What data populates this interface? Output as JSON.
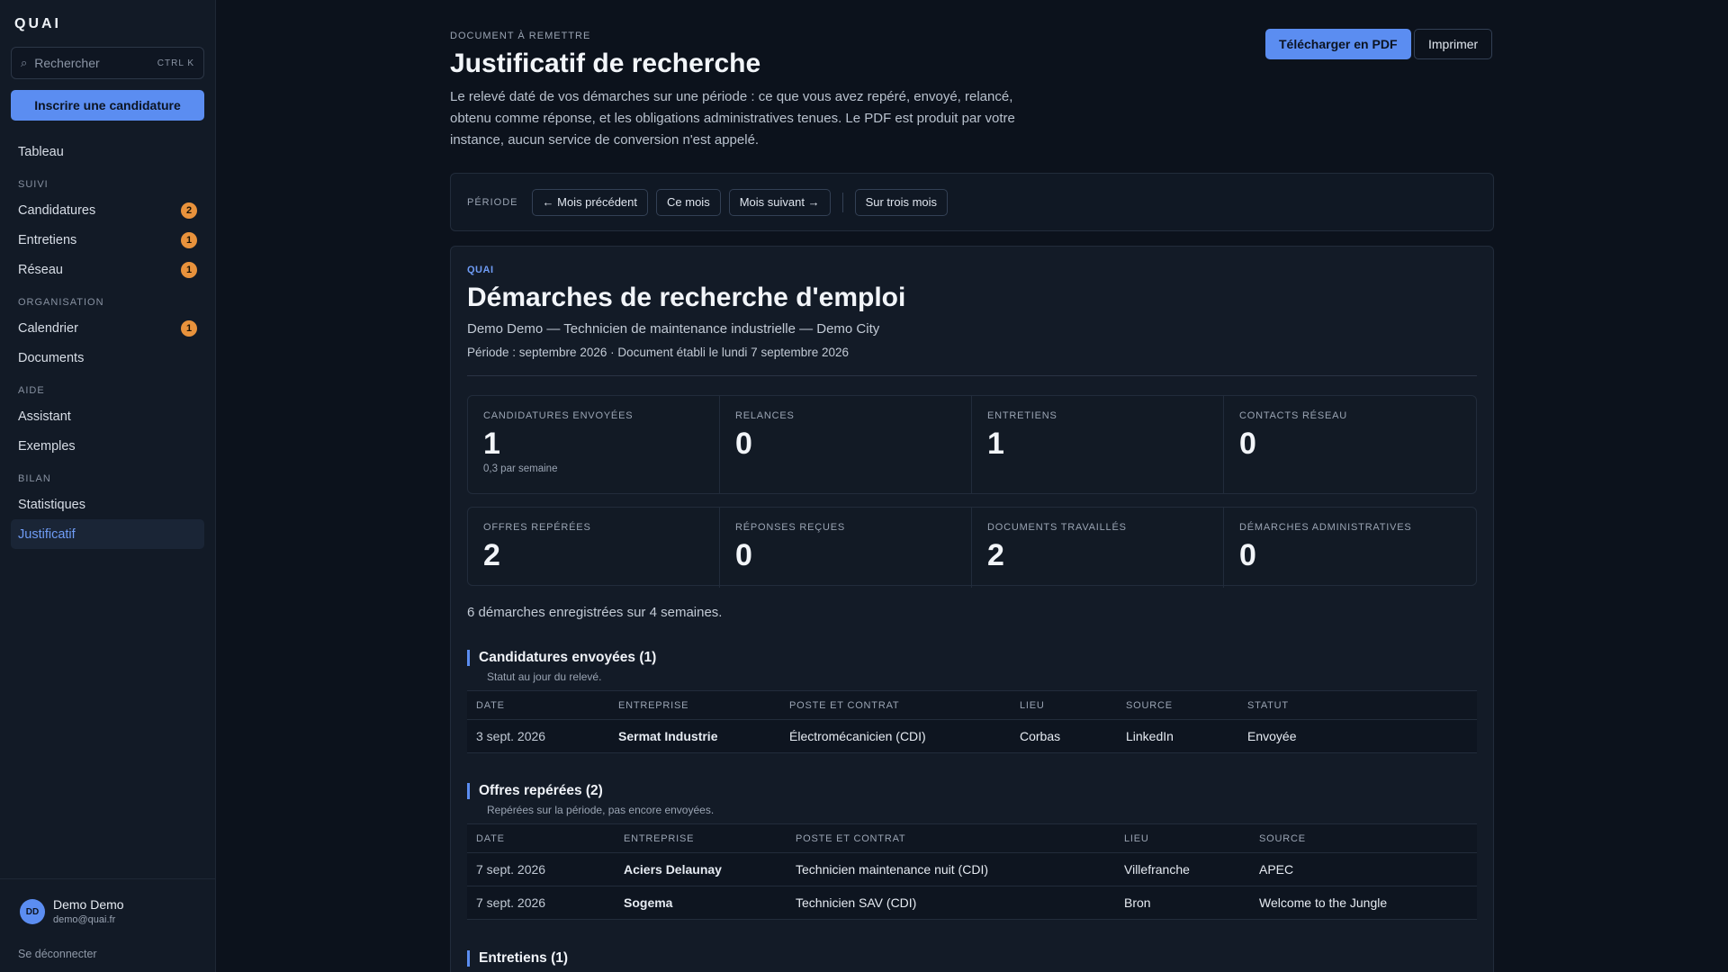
{
  "sidebar": {
    "brand": "QUAI",
    "search_placeholder": "Rechercher",
    "search_shortcut": "CTRL K",
    "cta": "Inscrire une candidature",
    "items": {
      "tableau": "Tableau",
      "suivi": "SUIVI",
      "candidatures": "Candidatures",
      "candidatures_count": "2",
      "entretiens": "Entretiens",
      "entretiens_count": "1",
      "reseau": "Réseau",
      "reseau_count": "1",
      "organisation": "ORGANISATION",
      "calendrier": "Calendrier",
      "calendrier_count": "1",
      "documents": "Documents",
      "aide": "AIDE",
      "assistant": "Assistant",
      "exemples": "Exemples",
      "bilan": "BILAN",
      "statistiques": "Statistiques",
      "justificatif": "Justificatif"
    },
    "user": {
      "initials": "DD",
      "name": "Demo Demo",
      "email": "demo@quai.fr"
    },
    "logout": "Se déconnecter"
  },
  "header": {
    "eyebrow": "DOCUMENT À REMETTRE",
    "title": "Justificatif de recherche",
    "intro": "Le relevé daté de vos démarches sur une période : ce que vous avez repéré, envoyé, relancé, obtenu comme réponse, et les obligations administratives tenues. Le PDF est produit par votre instance, aucun service de conversion n'est appelé.",
    "download": "Télécharger en PDF",
    "print": "Imprimer"
  },
  "period": {
    "label": "PÉRIODE",
    "prev": "← Mois précédent",
    "current": "Ce mois",
    "next": "Mois suivant →",
    "three": "Sur trois mois"
  },
  "doc": {
    "brand": "QUAI",
    "title": "Démarches de recherche d'emploi",
    "subtitle": "Demo Demo — Technicien de maintenance industrielle — Demo City",
    "meta": "Période : septembre 2026 · Document établi le lundi 7 septembre 2026",
    "stats_row1": [
      {
        "label": "CANDIDATURES ENVOYÉES",
        "value": "1",
        "note": "0,3 par semaine"
      },
      {
        "label": "RELANCES",
        "value": "0"
      },
      {
        "label": "ENTRETIENS",
        "value": "1"
      },
      {
        "label": "CONTACTS RÉSEAU",
        "value": "0"
      }
    ],
    "stats_row2": [
      {
        "label": "OFFRES REPÉRÉES",
        "value": "2"
      },
      {
        "label": "RÉPONSES REÇUES",
        "value": "0"
      },
      {
        "label": "DOCUMENTS TRAVAILLÉS",
        "value": "2"
      },
      {
        "label": "DÉMARCHES ADMINISTRATIVES",
        "value": "0"
      }
    ],
    "summary": "6 démarches enregistrées sur 4 semaines.",
    "sent": {
      "title": "Candidatures envoyées (1)",
      "note": "Statut au jour du relevé.",
      "headers": [
        "DATE",
        "ENTREPRISE",
        "POSTE ET CONTRAT",
        "LIEU",
        "SOURCE",
        "STATUT"
      ],
      "rows": [
        [
          "3 sept. 2026",
          "Sermat Industrie",
          "Électromécanicien (CDI)",
          "Corbas",
          "LinkedIn",
          "Envoyée"
        ]
      ]
    },
    "spotted": {
      "title": "Offres repérées (2)",
      "note": "Repérées sur la période, pas encore envoyées.",
      "headers": [
        "DATE",
        "ENTREPRISE",
        "POSTE ET CONTRAT",
        "LIEU",
        "SOURCE"
      ],
      "rows": [
        [
          "7 sept. 2026",
          "Aciers Delaunay",
          "Technicien maintenance nuit (CDI)",
          "Villefranche",
          "APEC"
        ],
        [
          "7 sept. 2026",
          "Sogema",
          "Technicien SAV (CDI)",
          "Bron",
          "Welcome to the Jungle"
        ]
      ]
    },
    "interviews": {
      "title": "Entretiens (1)"
    }
  }
}
